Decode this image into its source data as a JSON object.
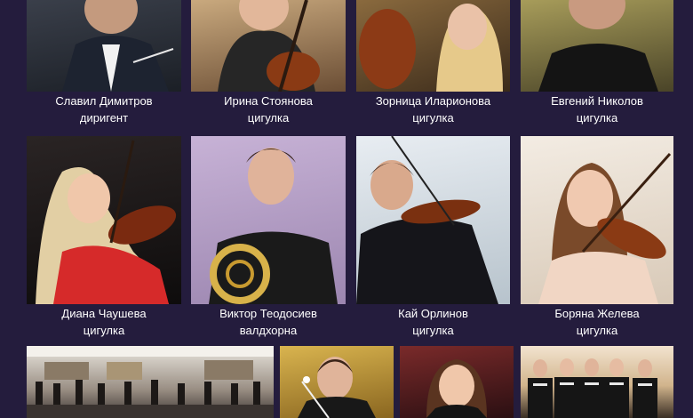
{
  "row1": [
    {
      "name": "Славил Димитров",
      "role": "диригент"
    },
    {
      "name": "Ирина Стоянова",
      "role": "цигулка"
    },
    {
      "name": "Зорница Иларионова",
      "role": "цигулка"
    },
    {
      "name": "Евгений Николов",
      "role": "цигулка"
    }
  ],
  "row2": [
    {
      "name": "Диана Чаушева",
      "role": "цигулка"
    },
    {
      "name": "Виктор Теодосиев",
      "role": "валдхорна"
    },
    {
      "name": "Кай Орлинов",
      "role": "цигулка"
    },
    {
      "name": "Боряна Желева",
      "role": "цигулка"
    }
  ],
  "row3_photos": [
    "orchestra-hall-photo",
    "conductor-photo",
    "young-violinist-photo",
    "ensemble-group-photo"
  ],
  "colors": {
    "background": "#241c3d",
    "caption_text": "#ffffff"
  }
}
